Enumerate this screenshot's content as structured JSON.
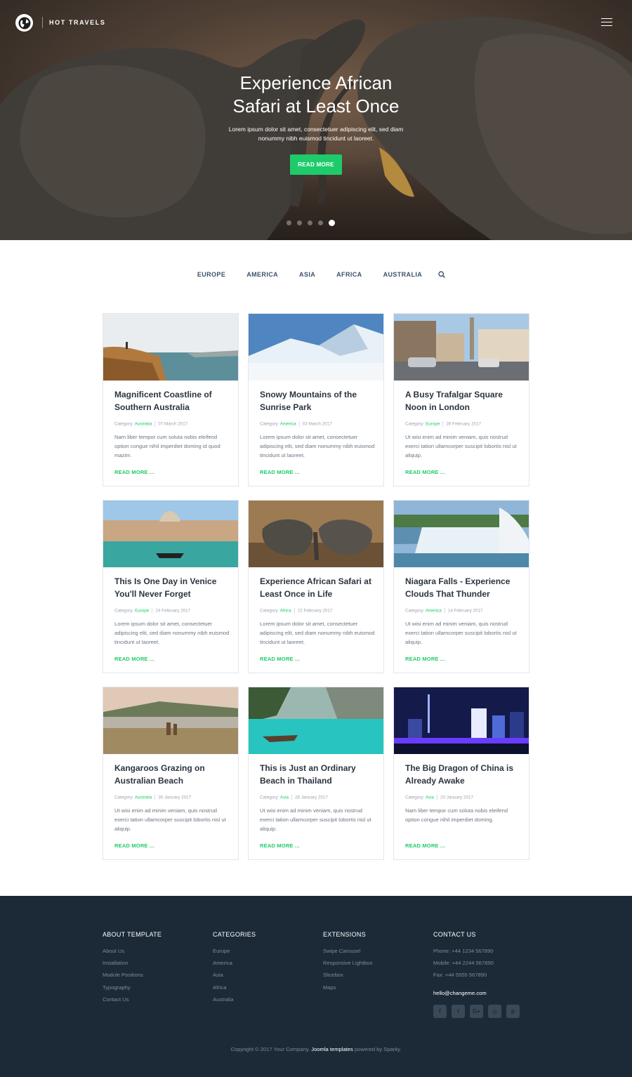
{
  "header": {
    "brand": "HOT TRAVELS",
    "logo_icon": "globe-icon",
    "menu_icon": "hamburger-icon"
  },
  "hero": {
    "title_line1": "Experience African",
    "title_line2": "Safari at Least Once",
    "subtitle": "Lorem ipsum dolor sit amet, consectetuer adipiscing elit, sed diam nonummy nibh euismod tincidunt ut laoreet.",
    "button": "READ MORE",
    "slides_total": 5,
    "slide_active": 5
  },
  "categories_nav": {
    "items": [
      "EUROPE",
      "AMERICA",
      "ASIA",
      "AFRICA",
      "AUSTRALIA"
    ],
    "search_icon": "search-icon"
  },
  "colors": {
    "accent": "#1ecb6a",
    "footer_bg": "#1c2a38",
    "nav_text": "#3d5169"
  },
  "cards": [
    {
      "title": "Magnificent Coastline of Southern Australia",
      "meta_label": "Category:",
      "category": "Australia",
      "date": "07 March 2017",
      "excerpt": "Nam liber tempor cum soluta nobis eleifend option congue nihil imperdiet doming id quod mazim.",
      "read_more": "READ MORE ..."
    },
    {
      "title": "Snowy Mountains of the Sunrise Park",
      "meta_label": "Category:",
      "category": "America",
      "date": "03 March 2017",
      "excerpt": "Lorem ipsum dolor sit amet, consectetuer adipiscing elit, sed diam nonummy nibh euismod tincidunt ut laoreet.",
      "read_more": "READ MORE ..."
    },
    {
      "title": "A Busy Trafalgar Square Noon in London",
      "meta_label": "Category:",
      "category": "Europe",
      "date": "28 February 2017",
      "excerpt": "Ut wisi enim ad minim veniam, quis nostrud exerci tation ullamcorper suscipit lobortis nisl ut aliquip.",
      "read_more": "READ MORE ..."
    },
    {
      "title": "This Is One Day in Venice You'll Never Forget",
      "meta_label": "Category:",
      "category": "Europe",
      "date": "24 February 2017",
      "excerpt": "Lorem ipsum dolor sit amet, consectetuer adipiscing elit, sed diam nonummy nibh euismod tincidunt ut laoreet.",
      "read_more": "READ MORE ..."
    },
    {
      "title": "Experience African Safari at Least Once in Life",
      "meta_label": "Category:",
      "category": "Africa",
      "date": "22 February 2017",
      "excerpt": "Lorem ipsum dolor sit amet, consectetuer adipiscing elit, sed diam nonummy nibh euismod tincidunt ut laoreet.",
      "read_more": "READ MORE ..."
    },
    {
      "title": "Niagara Falls - Experience Clouds That Thunder",
      "meta_label": "Category:",
      "category": "America",
      "date": "14 February 2017",
      "excerpt": "Ut wisi enim ad minim veniam, quis nostrud exerci tation ullamcorper suscipit lobortis nisl ut aliquip.",
      "read_more": "READ MORE ..."
    },
    {
      "title": "Kangaroos Grazing on Australian Beach",
      "meta_label": "Category:",
      "category": "Australia",
      "date": "30 January 2017",
      "excerpt": "Ut wisi enim ad minim veniam, quis nostrud exerci tation ullamcorper suscipit lobortis nisl ut aliquip.",
      "read_more": "READ MORE ..."
    },
    {
      "title": "This is Just an Ordinary Beach in Thailand",
      "meta_label": "Category:",
      "category": "Asia",
      "date": "28 January 2017",
      "excerpt": "Ut wisi enim ad minim veniam, quis nostrud exerci tation ullamcorper suscipit lobortis nisl ut aliquip.",
      "read_more": "READ MORE ..."
    },
    {
      "title": "The Big Dragon of China is Already Awake",
      "meta_label": "Category:",
      "category": "Asia",
      "date": "20 January 2017",
      "excerpt": "Nam liber tempor cum soluta nobis eleifend option congue nihil imperdiet doming.",
      "read_more": "READ MORE ..."
    }
  ],
  "footer": {
    "about": {
      "title": "ABOUT TEMPLATE",
      "links": [
        "About Us",
        "Installation",
        "Module Positions",
        "Typography",
        "Contact Us"
      ]
    },
    "categories": {
      "title": "CATEGORIES",
      "links": [
        "Europe",
        "America",
        "Asia",
        "Africa",
        "Australia"
      ]
    },
    "extensions": {
      "title": "EXTENSIONS",
      "links": [
        "Swipe Carousel",
        "Responsive Lightbox",
        "Slicebox",
        "Maps"
      ]
    },
    "contact": {
      "title": "CONTACT US",
      "phone": "Phone: +44 1234 567890",
      "mobile": "Mobile: +44 2244 567890",
      "fax": "Fax: +44 5555 567890",
      "email": "hello@changeme.com",
      "social": [
        "facebook-icon",
        "twitter-icon",
        "google-plus-icon",
        "instagram-icon",
        "pinterest-icon"
      ]
    },
    "copyright_pre": "Copyright © 2017 Your Company.",
    "copyright_link": "Joomla templates",
    "copyright_post": "powered by Sparky."
  }
}
